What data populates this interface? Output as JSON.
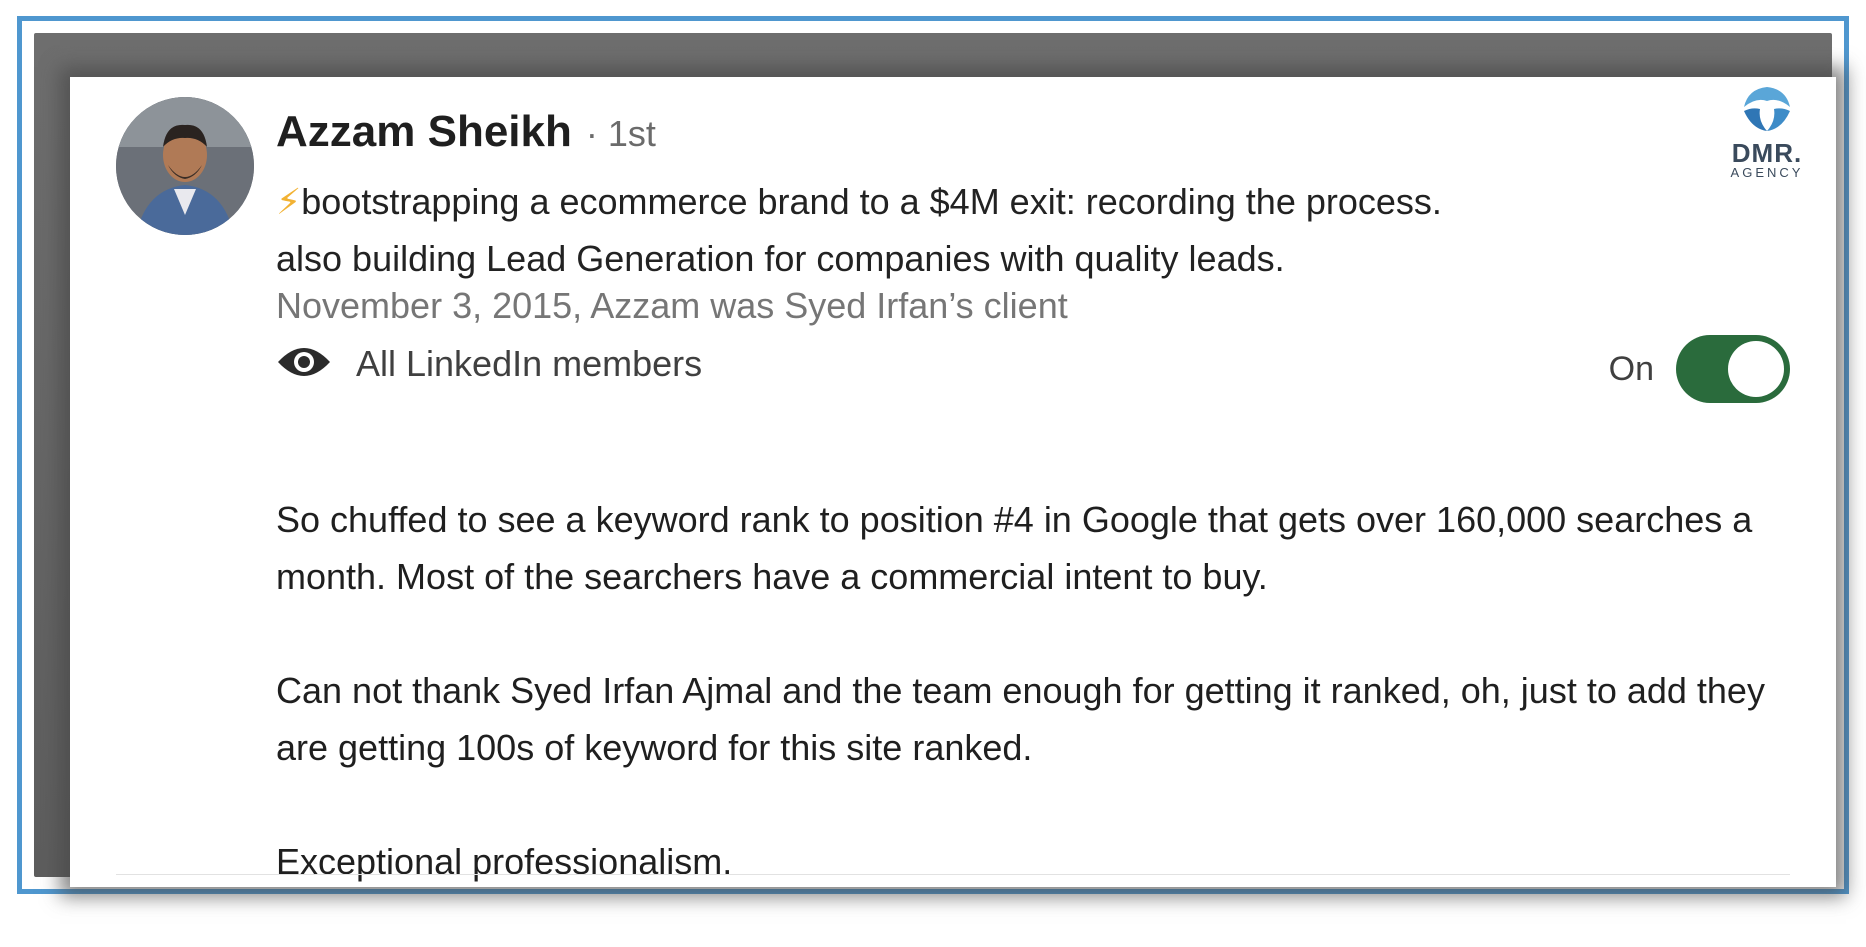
{
  "author": {
    "name": "Azzam Sheikh",
    "degree": "· 1st",
    "headline_icon": "⚡",
    "headline_line1": "bootstrapping a ecommerce brand to a $4M exit: recording the process.",
    "headline_line2": "also building Lead Generation for companies with quality leads."
  },
  "meta": {
    "date_relation": "November 3, 2015, Azzam was Syed Irfan’s client"
  },
  "visibility": {
    "icon": "eye-icon",
    "label": "All LinkedIn members",
    "toggle_label": "On",
    "toggle_on": true,
    "toggle_color": "#2a6b3c"
  },
  "recommendation": {
    "paragraph1": "So chuffed to see a keyword rank to position #4 in Google that gets over 160,000 searches a month. Most of the searchers have a commercial intent to buy.",
    "paragraph2": "Can not thank Syed Irfan Ajmal and the team enough for getting it ranked, oh, just to add they are getting 100s of keyword for this site ranked.",
    "paragraph3": "Exceptional professionalism."
  },
  "watermark": {
    "brand": "DMR.",
    "sub": "AGENCY"
  },
  "colors": {
    "frame_border": "#4f97cf",
    "headline_bolt": "#f2b233"
  }
}
